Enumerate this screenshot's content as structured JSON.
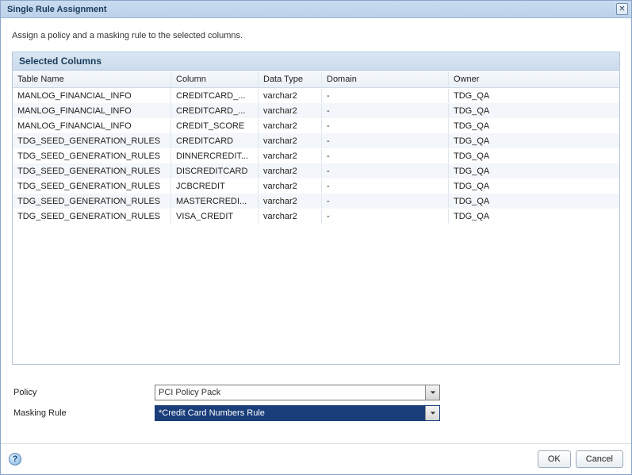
{
  "window": {
    "title": "Single Rule Assignment"
  },
  "instruction": "Assign a policy and a masking rule to the selected columns.",
  "panel": {
    "title": "Selected Columns"
  },
  "columns": {
    "table_name": "Table Name",
    "column": "Column",
    "data_type": "Data Type",
    "domain": "Domain",
    "owner": "Owner"
  },
  "rows": [
    {
      "table": "MANLOG_FINANCIAL_INFO",
      "column": "CREDITCARD_...",
      "dtype": "varchar2",
      "domain": "-",
      "owner": "TDG_QA"
    },
    {
      "table": "MANLOG_FINANCIAL_INFO",
      "column": "CREDITCARD_...",
      "dtype": "varchar2",
      "domain": "-",
      "owner": "TDG_QA"
    },
    {
      "table": "MANLOG_FINANCIAL_INFO",
      "column": "CREDIT_SCORE",
      "dtype": "varchar2",
      "domain": "-",
      "owner": "TDG_QA"
    },
    {
      "table": "TDG_SEED_GENERATION_RULES",
      "column": "CREDITCARD",
      "dtype": "varchar2",
      "domain": "-",
      "owner": "TDG_QA"
    },
    {
      "table": "TDG_SEED_GENERATION_RULES",
      "column": "DINNERCREDIT...",
      "dtype": "varchar2",
      "domain": "-",
      "owner": "TDG_QA"
    },
    {
      "table": "TDG_SEED_GENERATION_RULES",
      "column": "DISCREDITCARD",
      "dtype": "varchar2",
      "domain": "-",
      "owner": "TDG_QA"
    },
    {
      "table": "TDG_SEED_GENERATION_RULES",
      "column": "JCBCREDIT",
      "dtype": "varchar2",
      "domain": "-",
      "owner": "TDG_QA"
    },
    {
      "table": "TDG_SEED_GENERATION_RULES",
      "column": "MASTERCREDI...",
      "dtype": "varchar2",
      "domain": "-",
      "owner": "TDG_QA"
    },
    {
      "table": "TDG_SEED_GENERATION_RULES",
      "column": "VISA_CREDIT",
      "dtype": "varchar2",
      "domain": "-",
      "owner": "TDG_QA"
    }
  ],
  "form": {
    "policy_label": "Policy",
    "policy_value": "PCI Policy Pack",
    "masking_label": "Masking Rule",
    "masking_value": "*Credit Card Numbers Rule"
  },
  "buttons": {
    "ok": "OK",
    "cancel": "Cancel"
  }
}
